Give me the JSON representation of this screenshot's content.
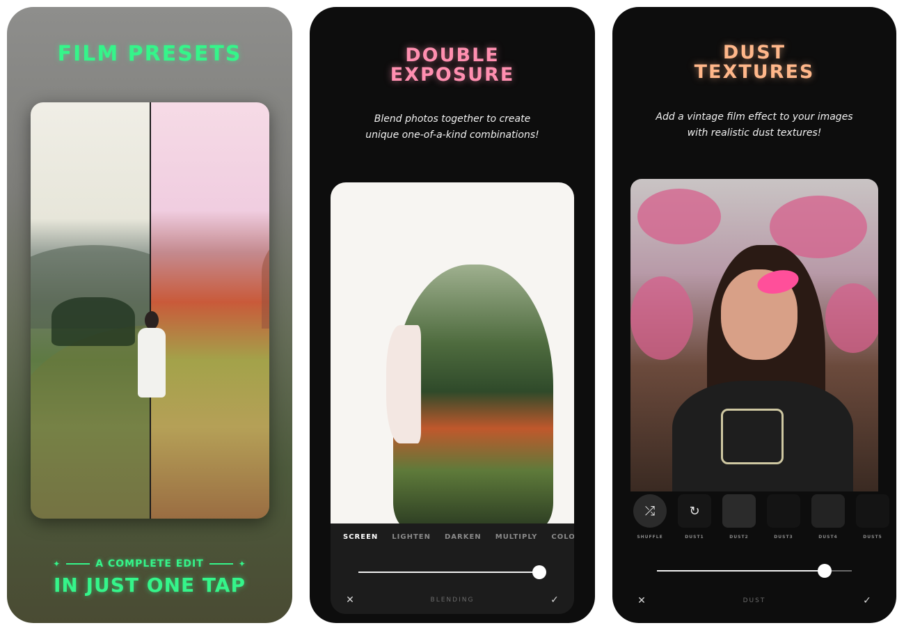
{
  "card1": {
    "title": "FILM PRESETS",
    "tag": "A COMPLETE EDIT",
    "tagline": "IN JUST ONE TAP",
    "title_color": "#35f58a"
  },
  "card2": {
    "title_line1": "DOUBLE",
    "title_line2": "EXPOSURE",
    "subtitle_line1": "Blend photos together to create",
    "subtitle_line2": "unique one-of-a-kind combinations!",
    "title_color": "#ff8fb0",
    "blend_modes": [
      "SCREEN",
      "LIGHTEN",
      "DARKEN",
      "MULTIPLY",
      "COLORBU"
    ],
    "active_mode": "SCREEN",
    "slider_value": 1.0,
    "bottom_label": "BLENDING",
    "close_icon": "close-icon",
    "confirm_icon": "checkmark-icon"
  },
  "card3": {
    "title_line1": "DUST",
    "title_line2": "TEXTURES",
    "subtitle_line1": "Add a vintage film effect to your images",
    "subtitle_line2": "with realistic dust textures!",
    "title_color": "#ffb78a",
    "thumbs": [
      {
        "label": "SHUFFLE",
        "icon": "shuffle-icon"
      },
      {
        "label": "DUST1",
        "icon": "reset-icon"
      },
      {
        "label": "DUST2",
        "icon": ""
      },
      {
        "label": "DUST3",
        "icon": ""
      },
      {
        "label": "DUST4",
        "icon": ""
      },
      {
        "label": "DUST5",
        "icon": ""
      }
    ],
    "slider_value": 0.86,
    "bottom_label": "DUST",
    "close_icon": "close-icon",
    "confirm_icon": "checkmark-icon"
  }
}
